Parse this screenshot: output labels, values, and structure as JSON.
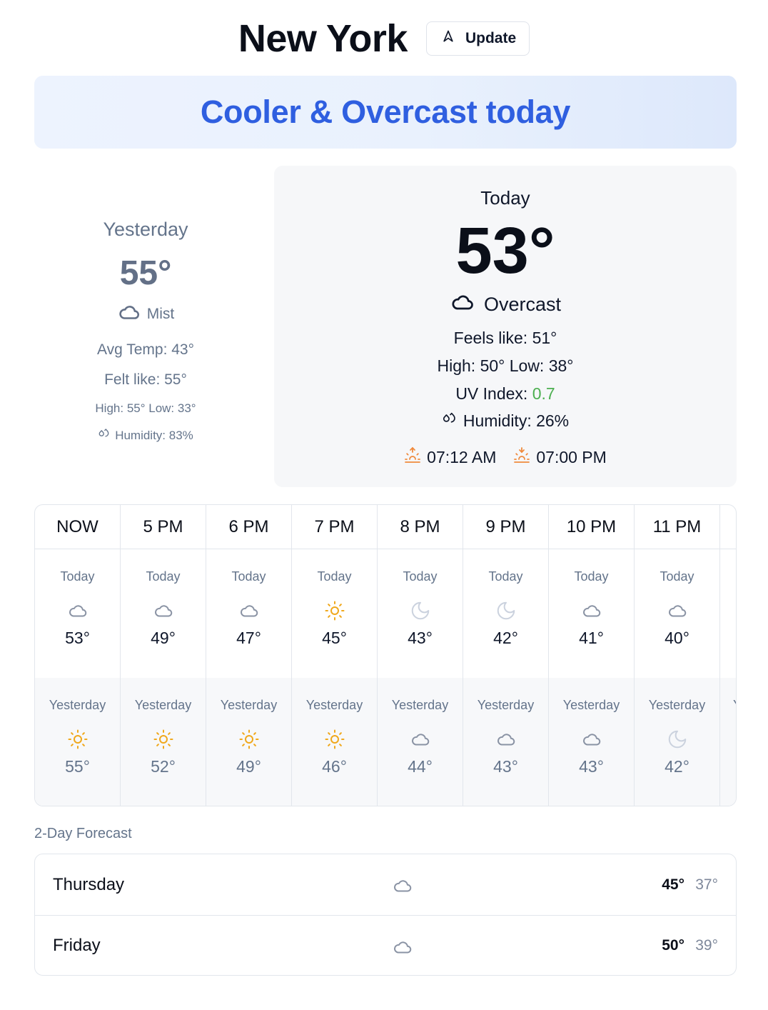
{
  "header": {
    "city": "New York",
    "update_label": "Update"
  },
  "banner": {
    "text": "Cooler & Overcast today"
  },
  "yesterday": {
    "label": "Yesterday",
    "temp": "55°",
    "condition": "Mist",
    "condition_icon": "cloud-icon",
    "avg_temp": "Avg Temp: 43°",
    "felt_like": "Felt like: 55°",
    "high_low": "High: 55° Low: 33°",
    "humidity": "Humidity: 83%"
  },
  "today": {
    "label": "Today",
    "temp": "53°",
    "condition": "Overcast",
    "condition_icon": "cloud-icon",
    "feels_like": "Feels like: 51°",
    "high_low": "High: 50° Low: 38°",
    "uv_label": "UV Index: ",
    "uv_value": "0.7",
    "humidity": "Humidity: 26%",
    "sunrise": "07:12 AM",
    "sunset": "07:00 PM"
  },
  "hourly": [
    {
      "time": "NOW",
      "today_label": "Today",
      "today_icon": "cloud",
      "today_temp": "53°",
      "yesterday_label": "Yesterday",
      "yesterday_icon": "sun",
      "yesterday_temp": "55°"
    },
    {
      "time": "5 PM",
      "today_label": "Today",
      "today_icon": "cloud",
      "today_temp": "49°",
      "yesterday_label": "Yesterday",
      "yesterday_icon": "sun",
      "yesterday_temp": "52°"
    },
    {
      "time": "6 PM",
      "today_label": "Today",
      "today_icon": "cloud",
      "today_temp": "47°",
      "yesterday_label": "Yesterday",
      "yesterday_icon": "sun",
      "yesterday_temp": "49°"
    },
    {
      "time": "7 PM",
      "today_label": "Today",
      "today_icon": "sun",
      "today_temp": "45°",
      "yesterday_label": "Yesterday",
      "yesterday_icon": "sun",
      "yesterday_temp": "46°"
    },
    {
      "time": "8 PM",
      "today_label": "Today",
      "today_icon": "moon",
      "today_temp": "43°",
      "yesterday_label": "Yesterday",
      "yesterday_icon": "cloud",
      "yesterday_temp": "44°"
    },
    {
      "time": "9 PM",
      "today_label": "Today",
      "today_icon": "moon",
      "today_temp": "42°",
      "yesterday_label": "Yesterday",
      "yesterday_icon": "cloud",
      "yesterday_temp": "43°"
    },
    {
      "time": "10 PM",
      "today_label": "Today",
      "today_icon": "cloud",
      "today_temp": "41°",
      "yesterday_label": "Yesterday",
      "yesterday_icon": "cloud",
      "yesterday_temp": "43°"
    },
    {
      "time": "11 PM",
      "today_label": "Today",
      "today_icon": "cloud",
      "today_temp": "40°",
      "yesterday_label": "Yesterday",
      "yesterday_icon": "moon",
      "yesterday_temp": "42°"
    }
  ],
  "hourly_overflow_label": "Y",
  "forecast": {
    "title": "2-Day Forecast",
    "days": [
      {
        "name": "Thursday",
        "icon": "cloud",
        "high": "45°",
        "low": "37°"
      },
      {
        "name": "Friday",
        "icon": "cloud",
        "high": "50°",
        "low": "39°"
      }
    ]
  },
  "colors": {
    "accent": "#2f5fe0",
    "sun": "#f0a81c",
    "sunrise": "#f08a3c",
    "uv": "#4caf50",
    "muted": "#64748b"
  }
}
